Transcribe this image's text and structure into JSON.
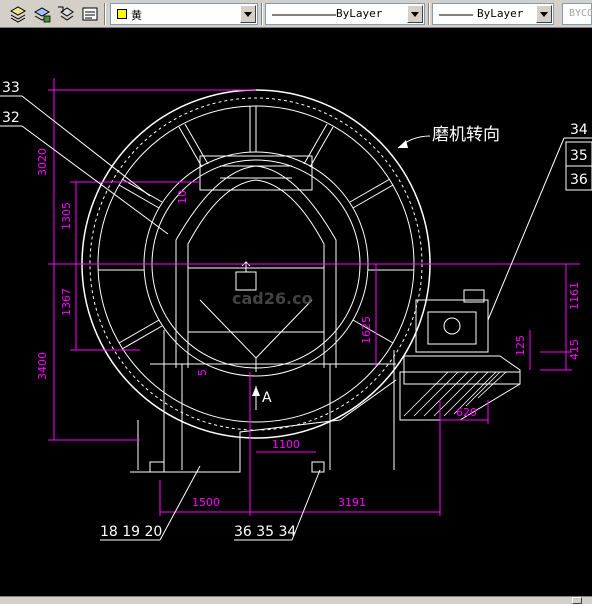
{
  "toolbar": {
    "layer_icons": [
      "layer-properties-icon",
      "layer-state-icon",
      "layer-previous-icon"
    ],
    "layer_name": "黄",
    "layer_color": "#ffff00",
    "linetype": "ByLayer",
    "lineweight": "ByLayer",
    "color": "BYCO"
  },
  "drawing": {
    "rotation_label": "磨机转向",
    "view_label": "A",
    "watermark": "cad26.co",
    "dims": {
      "d3020": "3020",
      "d1305": "1305",
      "d1367": "1367",
      "d3400": "3400",
      "d1625": "1625",
      "d1161": "1161",
      "d125": "125",
      "d415": "415",
      "d620": "620",
      "d1100": "1100",
      "d1500": "1500",
      "d3191": "3191",
      "d5": "5",
      "d10": "10"
    },
    "callouts": {
      "c33": "33",
      "c32": "32",
      "c34": "34",
      "c35": "35",
      "c36": "36",
      "bottom_left": "18 19 20",
      "bottom_right": "36 35 34"
    }
  },
  "colors": {
    "background": "#000000",
    "outline": "#ffffff",
    "dimension": "#ff00ff",
    "canvas_bg": "#000000"
  }
}
